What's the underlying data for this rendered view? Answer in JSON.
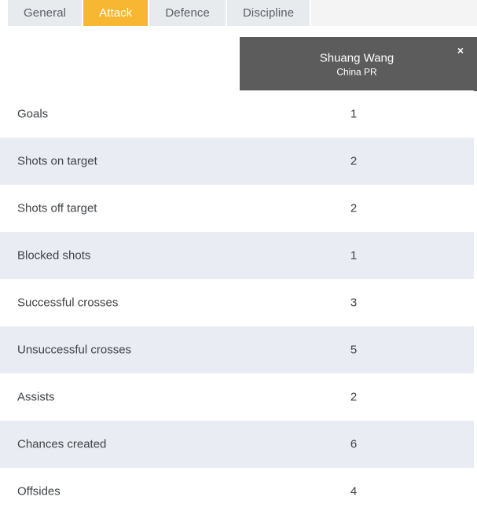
{
  "tabs": [
    {
      "label": "General",
      "active": false
    },
    {
      "label": "Attack",
      "active": true
    },
    {
      "label": "Defence",
      "active": false
    },
    {
      "label": "Discipline",
      "active": false
    }
  ],
  "player_card": {
    "name": "Shuang Wang",
    "team": "China PR",
    "close_label": "×"
  },
  "stats": [
    {
      "label": "Goals",
      "value": "1"
    },
    {
      "label": "Shots on target",
      "value": "2"
    },
    {
      "label": "Shots off target",
      "value": "2"
    },
    {
      "label": "Blocked shots",
      "value": "1"
    },
    {
      "label": "Successful crosses",
      "value": "3"
    },
    {
      "label": "Unsuccessful crosses",
      "value": "5"
    },
    {
      "label": "Assists",
      "value": "2"
    },
    {
      "label": "Chances created",
      "value": "6"
    },
    {
      "label": "Offsides",
      "value": "4"
    }
  ],
  "colors": {
    "active_tab": "#f8b733",
    "inactive_tab": "#e8ebee",
    "card_bg": "#5c5c5c",
    "row_alt": "#e9edf3",
    "text": "#3f4246"
  }
}
